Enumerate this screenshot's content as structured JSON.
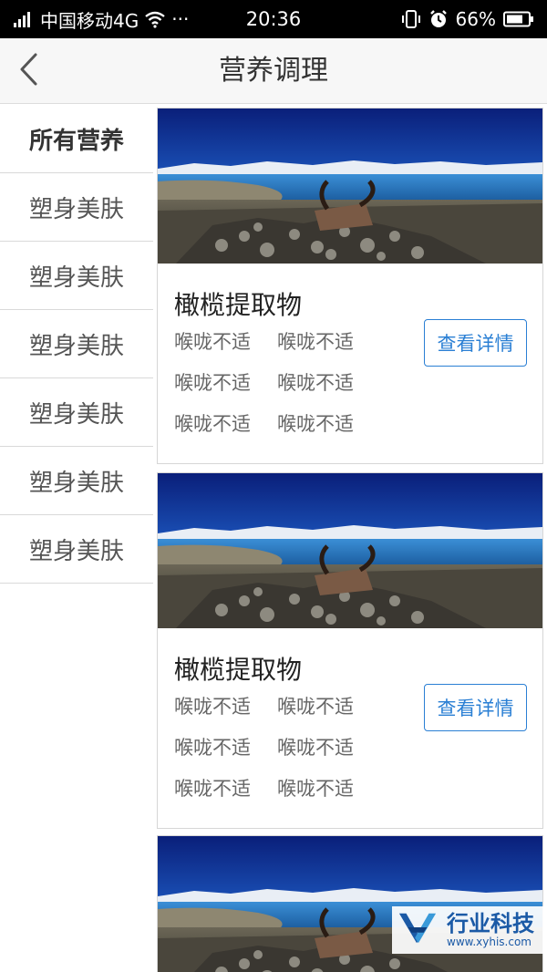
{
  "status_bar": {
    "carrier": "中国移动4G",
    "dots": "···",
    "time": "20:36",
    "battery": "66%",
    "icons": [
      "signal-icon",
      "wifi-icon",
      "vibrate-icon",
      "alarm-icon",
      "battery-icon"
    ]
  },
  "header": {
    "back_icon": "chevron-left-icon",
    "title": "营养调理"
  },
  "sidebar": {
    "items": [
      {
        "label": "所有营养",
        "active": true
      },
      {
        "label": "塑身美肤",
        "active": false
      },
      {
        "label": "塑身美肤",
        "active": false
      },
      {
        "label": "塑身美肤",
        "active": false
      },
      {
        "label": "塑身美肤",
        "active": false
      },
      {
        "label": "塑身美肤",
        "active": false
      },
      {
        "label": "塑身美肤",
        "active": false
      }
    ]
  },
  "cards": [
    {
      "image": "landscape-lake-yak-skull",
      "title": "橄榄提取物",
      "tags": [
        "喉咙不适",
        "喉咙不适",
        "喉咙不适",
        "喉咙不适",
        "喉咙不适",
        "喉咙不适"
      ],
      "button": "查看详情"
    },
    {
      "image": "landscape-lake-yak-skull",
      "title": "橄榄提取物",
      "tags": [
        "喉咙不适",
        "喉咙不适",
        "喉咙不适",
        "喉咙不适",
        "喉咙不适",
        "喉咙不适"
      ],
      "button": "查看详情"
    },
    {
      "image": "landscape-lake-yak-skull"
    }
  ],
  "watermark": {
    "name": "行业科技",
    "url": "www.xyhis.com"
  },
  "colors": {
    "accent": "#2a7fd4",
    "header_bg": "#f7f7f7",
    "divider": "#d9d9d9"
  }
}
